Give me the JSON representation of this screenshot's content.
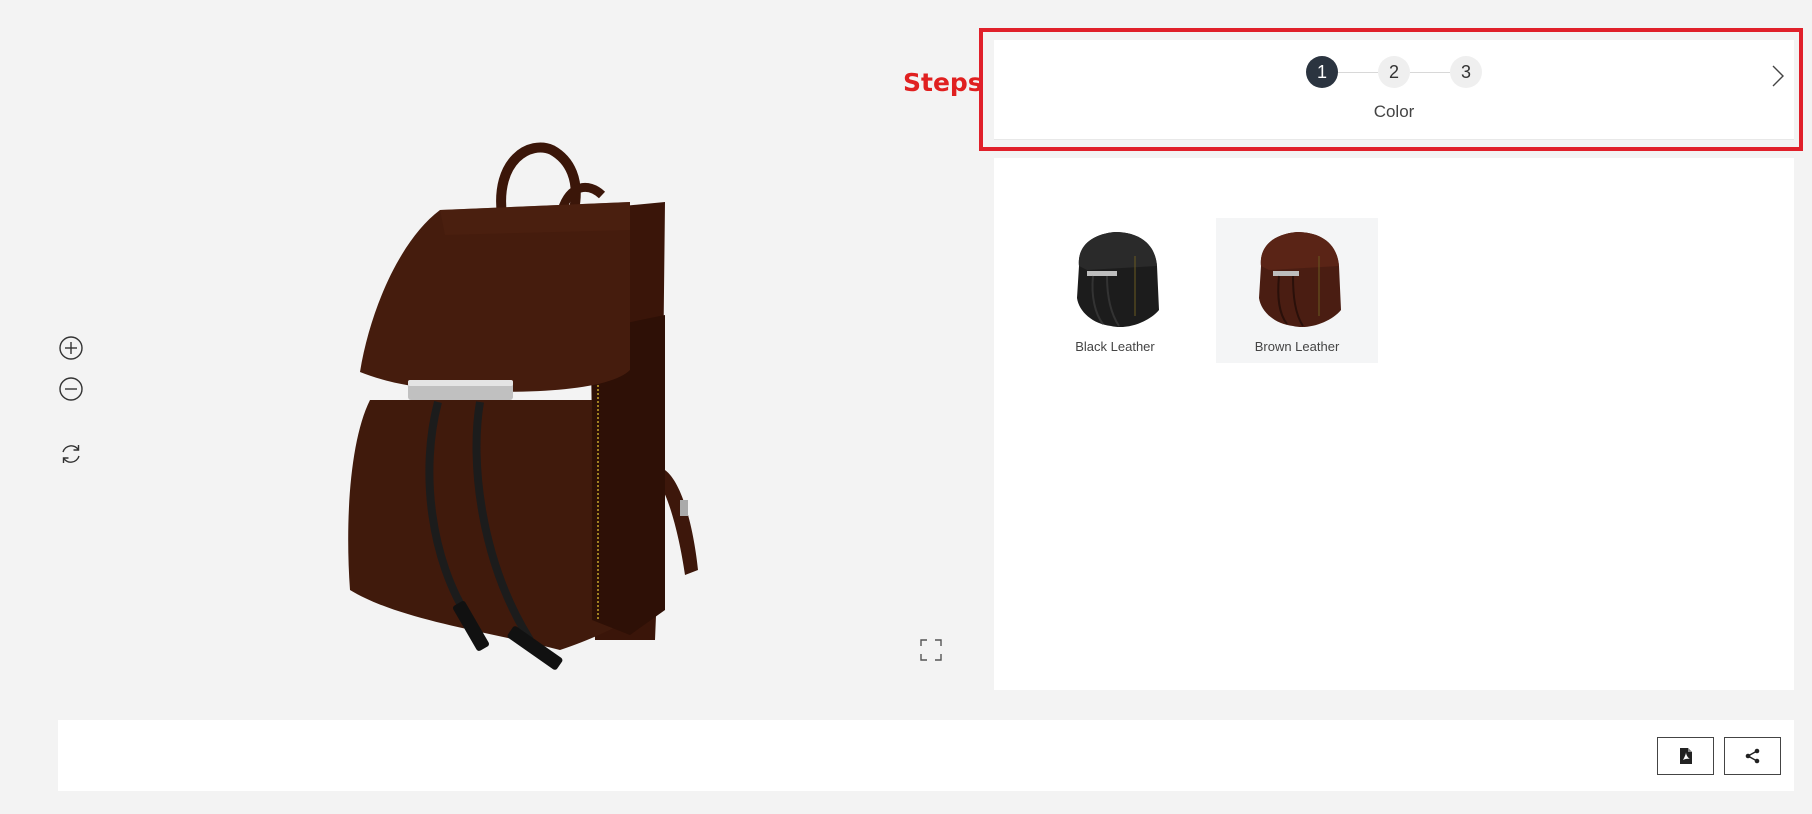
{
  "annotation": {
    "label": "Steps"
  },
  "steps": {
    "items": [
      "1",
      "2",
      "3"
    ],
    "active_index": 0,
    "active_name": "Color"
  },
  "options": [
    {
      "label": "Black Leather",
      "color": "#1c1c1c",
      "selected": false
    },
    {
      "label": "Brown Leather",
      "color": "#4a1d12",
      "selected": true
    }
  ],
  "viewer": {
    "controls": [
      "zoom-in-icon",
      "zoom-out-icon",
      "rotate-icon"
    ],
    "fullscreen_icon": "fullscreen-icon"
  },
  "bottom_bar": {
    "buttons": [
      "pdf-icon",
      "share-icon"
    ]
  },
  "colors": {
    "accent_step": "#2b3440",
    "annotation": "#e0202a",
    "product_leather": "#4a1d12"
  }
}
